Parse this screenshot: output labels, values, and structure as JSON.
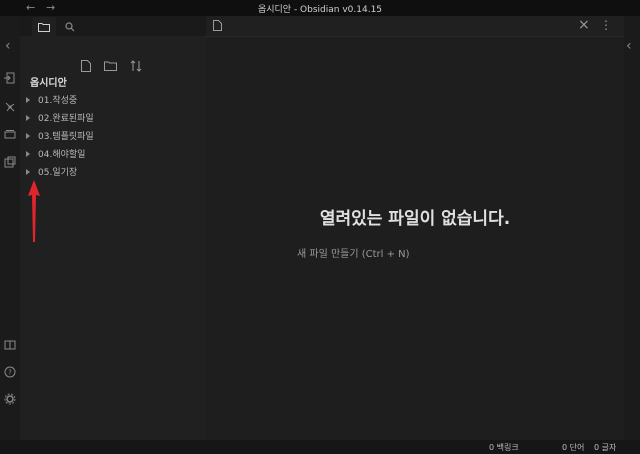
{
  "window": {
    "title": "옵시디안 - Obsidian v0.14.15",
    "back_glyph": "←",
    "forward_glyph": "→"
  },
  "sidebar": {
    "collapse_glyph": "‹",
    "tabs": [
      {
        "icon": "folder-icon",
        "active": true
      },
      {
        "icon": "search-icon",
        "active": false
      }
    ],
    "actions": [
      {
        "icon": "new-note-icon"
      },
      {
        "icon": "new-folder-icon"
      },
      {
        "icon": "sort-icon"
      }
    ],
    "vault_name": "옵시디안",
    "folders": [
      {
        "label": "01.작성중"
      },
      {
        "label": "02.완료된파일"
      },
      {
        "label": "03.템플릿파일"
      },
      {
        "label": "04.해야할일"
      },
      {
        "label": "05.일기장"
      }
    ]
  },
  "ribbon": {
    "icons": [
      "open-quick-switcher-icon",
      "graph-view-icon",
      "cards-icon",
      "command-palette-icon",
      "open-vault-icon",
      "help-icon",
      "settings-icon"
    ]
  },
  "workspace": {
    "empty_title": "열려있는 파일이 없습니다.",
    "new_file_hint": "새 파일 만들기 (Ctrl + N)",
    "close_glyph": "×",
    "more_glyph": "⋮"
  },
  "right_sidebar": {
    "expand_glyph": "‹"
  },
  "statusbar": {
    "backlinks": "0 백링크",
    "words": "0 단어",
    "characters": "0 글자"
  },
  "colors": {
    "background": "#1e1e1e",
    "sidebar": "#202020",
    "annotation_arrow": "#e0262b"
  }
}
